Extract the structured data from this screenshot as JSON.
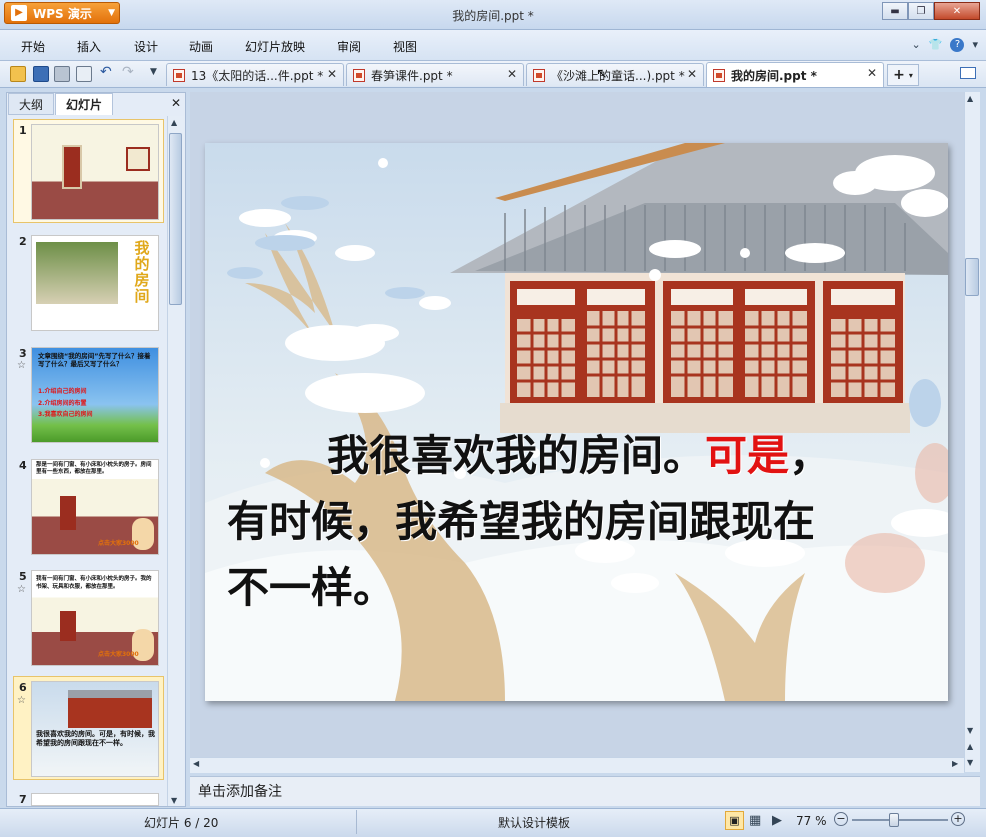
{
  "app": {
    "name": "WPS 演示",
    "window_title": "我的房间.ppt *"
  },
  "window_controls": {
    "minimize": "▬",
    "restore": "❐",
    "close": "✕"
  },
  "menu": {
    "items": [
      "开始",
      "插入",
      "设计",
      "动画",
      "幻灯片放映",
      "审阅",
      "视图"
    ]
  },
  "doc_tabs": [
    {
      "label": "13《太阳的话...件.ppt *"
    },
    {
      "label": "春笋课件.ppt *"
    },
    {
      "label": "《沙滩上的童话...).ppt *"
    },
    {
      "label": "我的房间.ppt *",
      "active": true
    }
  ],
  "side_panel": {
    "tabs": [
      "大纲",
      "幻灯片"
    ],
    "close": "✕",
    "slides": [
      {
        "num": "1"
      },
      {
        "num": "2",
        "text": "我的房间"
      },
      {
        "num": "3",
        "star": "☆",
        "text_lines": [
          "文章围绕“我的房间”先写了什么？接着写了什么？最后又写了什么？",
          "1.介绍自己的房间",
          "2.介绍房间的布置",
          "3.我喜欢自己的房间"
        ]
      },
      {
        "num": "4",
        "text": "那是一间有门窗、有小床和小枕头的房子。房间里有一些东西，都放在那里。",
        "tag": "点击大家3000"
      },
      {
        "num": "5",
        "star": "☆",
        "text": "我有一间有门窗、有小床和小枕头的房子。我的书架、玩具和衣服，都放在那里。",
        "tag": "点击大家3000"
      },
      {
        "num": "6",
        "star": "☆",
        "text": "我很喜欢我的房间。可是，有时候，我希望我的房间跟现在不一样。",
        "selected": true
      },
      {
        "num": "7"
      }
    ]
  },
  "slide": {
    "line1": "我很喜欢我的房间。",
    "line1_red": "可是",
    "line1_end": "，",
    "line2": "有时候，我希望我的房间跟现在",
    "line3": "不一样。"
  },
  "notes": {
    "placeholder": "单击添加备注"
  },
  "status": {
    "slide_counter": "幻灯片 6 / 20",
    "template": "默认设计模板",
    "zoom": "77 %",
    "zoom_value": 0.77
  },
  "colors": {
    "accent": "#e2710b",
    "selection": "#e8c46a",
    "red_text": "#e21212"
  }
}
